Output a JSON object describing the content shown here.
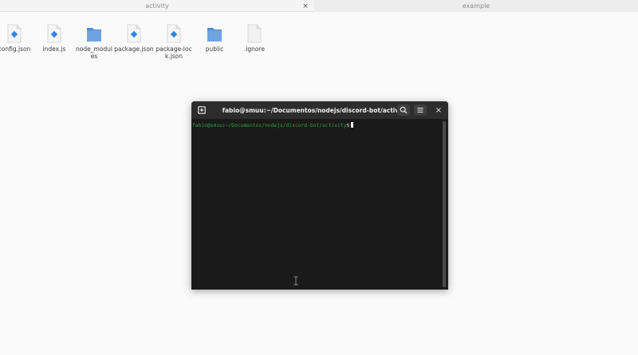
{
  "tabs": [
    {
      "label": "activity",
      "active": true
    },
    {
      "label": "example",
      "active": false
    }
  ],
  "tab_close_glyph": "×",
  "files": [
    {
      "label": "config.json",
      "icon": "json-file-icon"
    },
    {
      "label": "index.js",
      "icon": "js-file-icon"
    },
    {
      "label": "node_modules",
      "icon": "folder-icon"
    },
    {
      "label": "package.json",
      "icon": "json-file-icon"
    },
    {
      "label": "package-lock.json",
      "icon": "json-file-icon"
    },
    {
      "label": "public",
      "icon": "folder-icon"
    },
    {
      "label": ".ignore",
      "icon": "text-file-icon"
    }
  ],
  "terminal": {
    "title": "fabio@smuu:~/Documentos/nodejs/discord-bot/activity",
    "prompt_user": "fabio@smuu",
    "prompt_sep": ":",
    "prompt_path": "~/Documentos/nodejs/discord-bot/activity",
    "prompt_symbol": "$",
    "close_glyph": "×"
  },
  "colors": {
    "folder": "#6fa3e0",
    "js_badge": "#3584e4",
    "prompt_green": "#2ea04a"
  }
}
